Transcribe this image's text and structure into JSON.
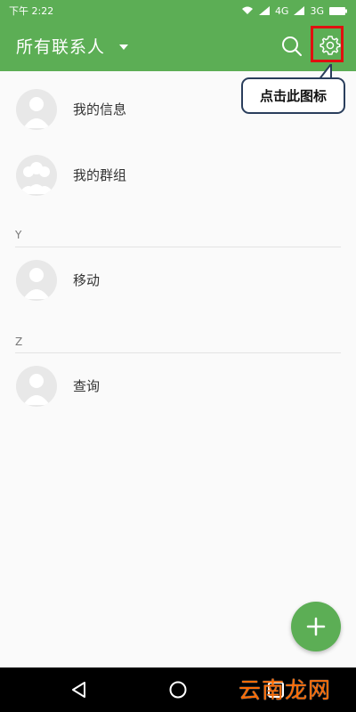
{
  "status_bar": {
    "time": "下午 2:22",
    "network_1": "4G",
    "network_2": "3G"
  },
  "header": {
    "title": "所有联系人",
    "dropdown_icon": "caret-down-icon",
    "search_icon": "search-icon",
    "settings_icon": "gear-icon"
  },
  "callout": {
    "text": "点击此图标"
  },
  "contacts": {
    "top": [
      {
        "name": "我的信息",
        "icon": "person-avatar-icon"
      },
      {
        "name": "我的群组",
        "icon": "group-avatar-icon"
      }
    ],
    "sections": [
      {
        "letter": "Y",
        "items": [
          {
            "name": "移动"
          }
        ]
      },
      {
        "letter": "Z",
        "items": [
          {
            "name": "查询"
          }
        ]
      }
    ]
  },
  "fab": {
    "icon": "plus-icon"
  },
  "nav_bar": {
    "back_icon": "back-triangle-icon",
    "home_icon": "home-circle-icon",
    "recent_icon": "recent-square-icon"
  },
  "watermark": {
    "text": "云南龙网"
  },
  "colors": {
    "primary": "#5cae55",
    "highlight": "#e01010",
    "callout_border": "#2a3e5c",
    "watermark": "#ff6a00"
  }
}
